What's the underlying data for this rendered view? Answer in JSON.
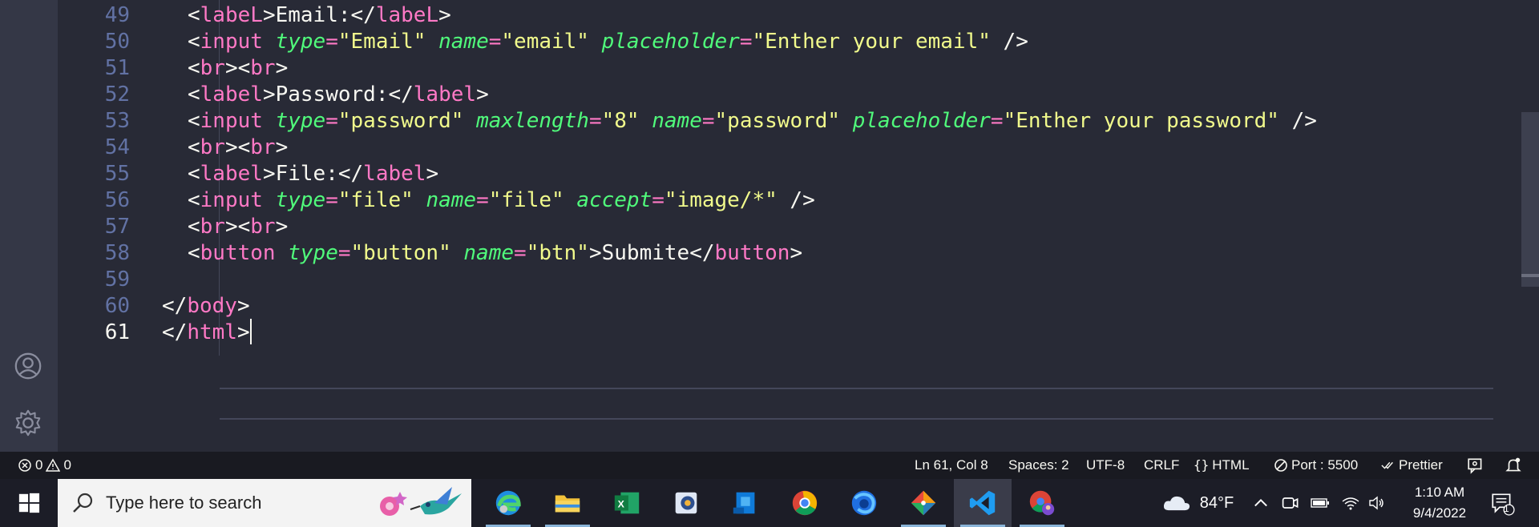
{
  "editor": {
    "lines": [
      {
        "num": "49",
        "tokens": [
          [
            "t-white",
            "<"
          ],
          [
            "t-pink",
            "labeL"
          ],
          [
            "t-white",
            ">Email:</"
          ],
          [
            "t-pink",
            "labeL"
          ],
          [
            "t-white",
            ">"
          ]
        ],
        "indent": true
      },
      {
        "num": "50",
        "tokens": [
          [
            "t-white",
            "<"
          ],
          [
            "t-pink",
            "input"
          ],
          [
            "t-white",
            " "
          ],
          [
            "t-green",
            "type"
          ],
          [
            "t-pink",
            "="
          ],
          [
            "t-yellow",
            "\"Email\""
          ],
          [
            "t-white",
            " "
          ],
          [
            "t-green",
            "name"
          ],
          [
            "t-pink",
            "="
          ],
          [
            "t-yellow",
            "\"email\""
          ],
          [
            "t-white",
            " "
          ],
          [
            "t-green",
            "placeholder"
          ],
          [
            "t-pink",
            "="
          ],
          [
            "t-yellow",
            "\"Enther your email\""
          ],
          [
            "t-white",
            " />"
          ]
        ],
        "indent": true
      },
      {
        "num": "51",
        "tokens": [
          [
            "t-white",
            "<"
          ],
          [
            "t-pink",
            "br"
          ],
          [
            "t-white",
            "><"
          ],
          [
            "t-pink",
            "br"
          ],
          [
            "t-white",
            ">"
          ]
        ],
        "indent": true
      },
      {
        "num": "52",
        "tokens": [
          [
            "t-white",
            "<"
          ],
          [
            "t-pink",
            "label"
          ],
          [
            "t-white",
            ">Password:</"
          ],
          [
            "t-pink",
            "label"
          ],
          [
            "t-white",
            ">"
          ]
        ],
        "indent": true
      },
      {
        "num": "53",
        "tokens": [
          [
            "t-white",
            "<"
          ],
          [
            "t-pink",
            "input"
          ],
          [
            "t-white",
            " "
          ],
          [
            "t-green",
            "type"
          ],
          [
            "t-pink",
            "="
          ],
          [
            "t-yellow",
            "\"password\""
          ],
          [
            "t-white",
            " "
          ],
          [
            "t-green",
            "maxlength"
          ],
          [
            "t-pink",
            "="
          ],
          [
            "t-yellow",
            "\"8\""
          ],
          [
            "t-white",
            " "
          ],
          [
            "t-green",
            "name"
          ],
          [
            "t-pink",
            "="
          ],
          [
            "t-yellow",
            "\"password\""
          ],
          [
            "t-white",
            " "
          ],
          [
            "t-green",
            "placeholder"
          ],
          [
            "t-pink",
            "="
          ],
          [
            "t-yellow",
            "\"Enther your password\""
          ],
          [
            "t-white",
            " />"
          ]
        ],
        "indent": true
      },
      {
        "num": "54",
        "tokens": [
          [
            "t-white",
            "<"
          ],
          [
            "t-pink",
            "br"
          ],
          [
            "t-white",
            "><"
          ],
          [
            "t-pink",
            "br"
          ],
          [
            "t-white",
            ">"
          ]
        ],
        "indent": true
      },
      {
        "num": "55",
        "tokens": [
          [
            "t-white",
            "<"
          ],
          [
            "t-pink",
            "label"
          ],
          [
            "t-white",
            ">File:</"
          ],
          [
            "t-pink",
            "label"
          ],
          [
            "t-white",
            ">"
          ]
        ],
        "indent": true
      },
      {
        "num": "56",
        "tokens": [
          [
            "t-white",
            "<"
          ],
          [
            "t-pink",
            "input"
          ],
          [
            "t-white",
            " "
          ],
          [
            "t-green",
            "type"
          ],
          [
            "t-pink",
            "="
          ],
          [
            "t-yellow",
            "\"file\""
          ],
          [
            "t-white",
            " "
          ],
          [
            "t-green",
            "name"
          ],
          [
            "t-pink",
            "="
          ],
          [
            "t-yellow",
            "\"file\""
          ],
          [
            "t-white",
            " "
          ],
          [
            "t-green",
            "accept"
          ],
          [
            "t-pink",
            "="
          ],
          [
            "t-yellow",
            "\"image/*\""
          ],
          [
            "t-white",
            " />"
          ]
        ],
        "indent": true
      },
      {
        "num": "57",
        "tokens": [
          [
            "t-white",
            "<"
          ],
          [
            "t-pink",
            "br"
          ],
          [
            "t-white",
            "><"
          ],
          [
            "t-pink",
            "br"
          ],
          [
            "t-white",
            ">"
          ]
        ],
        "indent": true
      },
      {
        "num": "58",
        "tokens": [
          [
            "t-white",
            "<"
          ],
          [
            "t-pink",
            "button"
          ],
          [
            "t-white",
            " "
          ],
          [
            "t-green",
            "type"
          ],
          [
            "t-pink",
            "="
          ],
          [
            "t-yellow",
            "\"button\""
          ],
          [
            "t-white",
            " "
          ],
          [
            "t-green",
            "name"
          ],
          [
            "t-pink",
            "="
          ],
          [
            "t-yellow",
            "\"btn\""
          ],
          [
            "t-white",
            ">Submite</"
          ],
          [
            "t-pink",
            "button"
          ],
          [
            "t-white",
            ">"
          ]
        ],
        "indent": true
      },
      {
        "num": "59",
        "tokens": [],
        "indent": false
      },
      {
        "num": "60",
        "tokens": [
          [
            "t-white",
            "</"
          ],
          [
            "t-pink",
            "body"
          ],
          [
            "t-white",
            ">"
          ]
        ],
        "indent": false
      },
      {
        "num": "61",
        "tokens": [
          [
            "t-white",
            "</"
          ],
          [
            "t-pink",
            "html"
          ],
          [
            "t-white",
            ">"
          ]
        ],
        "indent": false,
        "active": true
      }
    ]
  },
  "activity": {
    "account_icon": "account-icon",
    "settings_icon": "gear-icon"
  },
  "status": {
    "errors": "0",
    "warnings": "0",
    "position": "Ln 61, Col 8",
    "spaces": "Spaces: 2",
    "encoding": "UTF-8",
    "eol": "CRLF",
    "language": "HTML",
    "port": "Port : 5500",
    "prettier": "Prettier"
  },
  "taskbar": {
    "search_placeholder": "Type here to search",
    "apps": [
      "Microsoft Edge",
      "File Explorer",
      "Excel",
      "Photo viewer",
      "Microsoft Store",
      "Google Chrome",
      "Firefox",
      "Git tool",
      "Visual Studio Code",
      "Chrome profile"
    ],
    "temperature": "84°F",
    "time": "1:10 AM",
    "date": "9/4/2022",
    "notifications": "1"
  },
  "colors": {
    "bg": "#282a36",
    "pink": "#ff79c6",
    "green": "#50fa7b",
    "yellow": "#f1fa8c",
    "comment": "#6272a4"
  }
}
